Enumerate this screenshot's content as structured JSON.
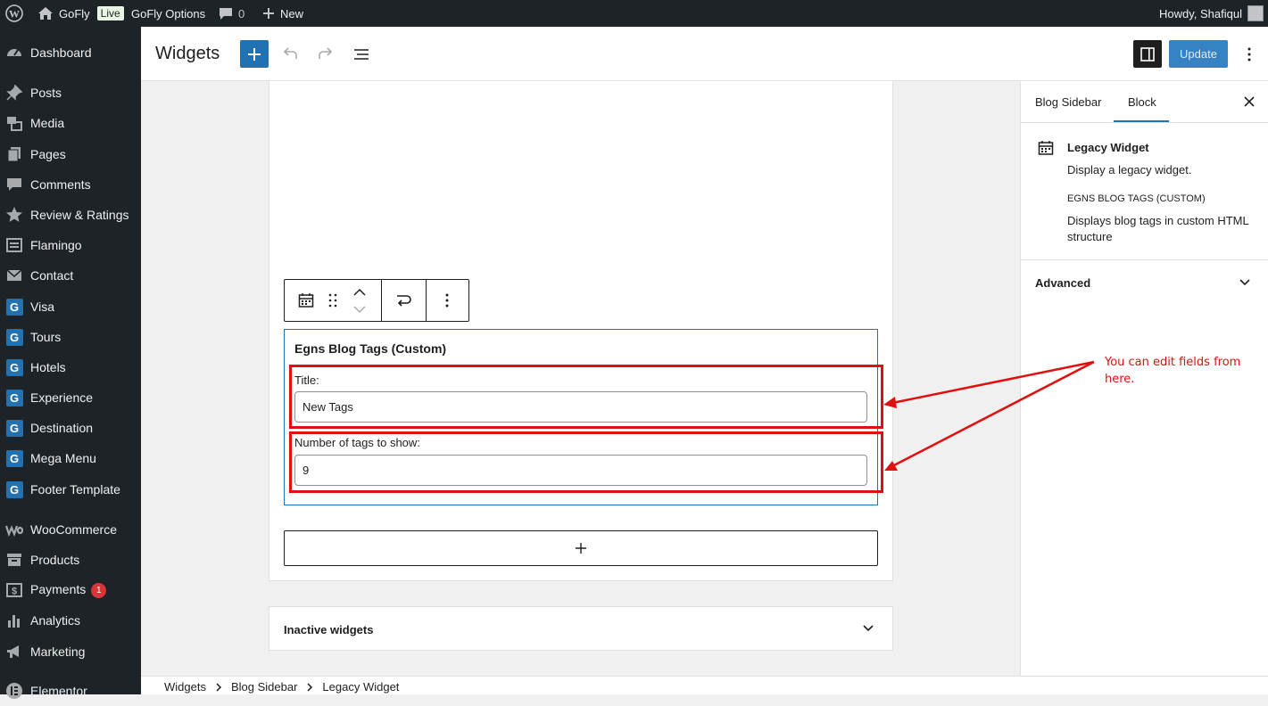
{
  "admin_bar": {
    "site_name": "GoFly",
    "live_badge": "Live",
    "options": "GoFly Options",
    "comments_count": "0",
    "new_label": "New",
    "howdy": "Howdy, Shafiqul"
  },
  "sidebar": {
    "items": [
      {
        "label": "Dashboard",
        "icon": "dashboard-icon"
      },
      {
        "label": "Posts",
        "icon": "pin-icon"
      },
      {
        "label": "Media",
        "icon": "media-icon"
      },
      {
        "label": "Pages",
        "icon": "pages-icon"
      },
      {
        "label": "Comments",
        "icon": "comment-icon"
      },
      {
        "label": "Review & Ratings",
        "icon": "star-icon"
      },
      {
        "label": "Flamingo",
        "icon": "flamingo-icon"
      },
      {
        "label": "Contact",
        "icon": "mail-icon"
      },
      {
        "label": "Visa",
        "icon": "g-icon"
      },
      {
        "label": "Tours",
        "icon": "g-icon"
      },
      {
        "label": "Hotels",
        "icon": "g-icon"
      },
      {
        "label": "Experience",
        "icon": "g-icon"
      },
      {
        "label": "Destination",
        "icon": "g-icon"
      },
      {
        "label": "Mega Menu",
        "icon": "g-icon"
      },
      {
        "label": "Footer Template",
        "icon": "g-icon"
      },
      {
        "label": "WooCommerce",
        "icon": "woo-icon"
      },
      {
        "label": "Products",
        "icon": "archive-icon"
      },
      {
        "label": "Payments",
        "icon": "dollar-icon",
        "badge": "1"
      },
      {
        "label": "Analytics",
        "icon": "chart-icon"
      },
      {
        "label": "Marketing",
        "icon": "megaphone-icon"
      },
      {
        "label": "Elementor",
        "icon": "elementor-icon"
      }
    ]
  },
  "header": {
    "title": "Widgets",
    "update_label": "Update"
  },
  "widget": {
    "title": "Egns Blog Tags (Custom)",
    "fields": [
      {
        "label": "Title:",
        "value": "New Tags"
      },
      {
        "label": "Number of tags to show:",
        "value": "9"
      }
    ]
  },
  "inactive": {
    "label": "Inactive widgets"
  },
  "breadcrumb": [
    "Widgets",
    "Blog Sidebar",
    "Legacy Widget"
  ],
  "settings": {
    "tabs": [
      "Blog Sidebar",
      "Block"
    ],
    "block_title": "Legacy Widget",
    "block_desc": "Display a legacy widget.",
    "widget_name": "EGNS BLOG TAGS (CUSTOM)",
    "widget_desc": "Displays blog tags in custom HTML structure",
    "advanced": "Advanced"
  },
  "annotation": "You can edit fields from here.",
  "colors": {
    "admin_dark": "#1d2327",
    "accent": "#2271b1",
    "annotation_red": "#e01010"
  }
}
